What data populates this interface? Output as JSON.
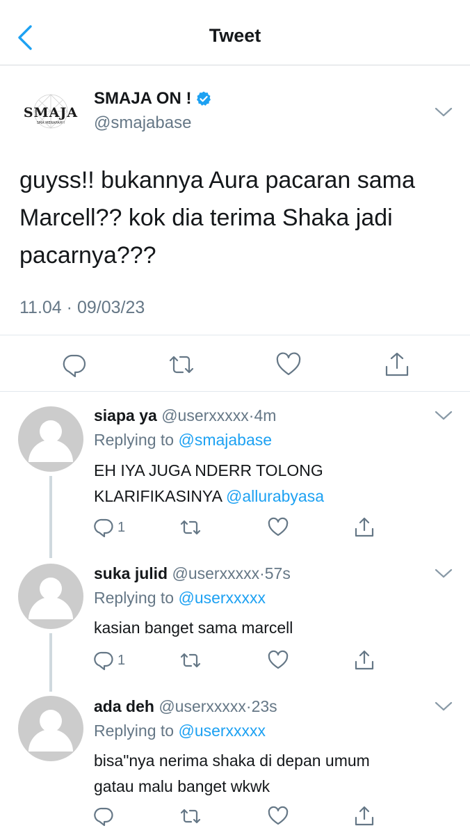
{
  "header": {
    "title": "Tweet",
    "back_icon": "chevron-left-icon"
  },
  "tweet": {
    "author_name": "SMAJA ON !",
    "author_handle": "@smajabase",
    "avatar_logo_text": "SMAJA",
    "avatar_logo_subtext": "SMA MERAPAH!!",
    "verified": true,
    "text": "guyss!! bukannya Aura pacaran sama Marcell?? kok dia terima Shaka jadi pacarnya???",
    "time": "11.04",
    "separator": "·",
    "date": "09/03/23",
    "actions": [
      "reply-icon",
      "retweet-icon",
      "like-icon",
      "share-icon"
    ]
  },
  "replies": [
    {
      "name": "siapa ya",
      "handle": "@userxxxxx",
      "dot": "·",
      "age": "4m",
      "replying_prefix": "Replying to",
      "replying_to": "@smajabase",
      "text_line1": "EH IYA JUGA NDERR TOLONG",
      "text_line2": "KLARIFIKASINYA",
      "text_mention": "@allurabyasa",
      "reply_count": "1"
    },
    {
      "name": "suka julid",
      "handle": "@userxxxxx",
      "dot": "·",
      "age": "57s",
      "replying_prefix": "Replying to",
      "replying_to": "@userxxxxx",
      "text_line1": "kasian banget sama marcell",
      "reply_count": "1"
    },
    {
      "name": "ada deh",
      "handle": "@userxxxxx",
      "dot": "·",
      "age": "23s",
      "replying_prefix": "Replying to",
      "replying_to": "@userxxxxx",
      "text_line1": "bisa\"nya nerima shaka di depan umum",
      "text_line2": "gatau malu banget wkwk",
      "reply_count": ""
    }
  ],
  "colors": {
    "accent": "#1da1f2",
    "text": "#14171a",
    "muted": "#657786",
    "divider": "#e1e8ed"
  }
}
